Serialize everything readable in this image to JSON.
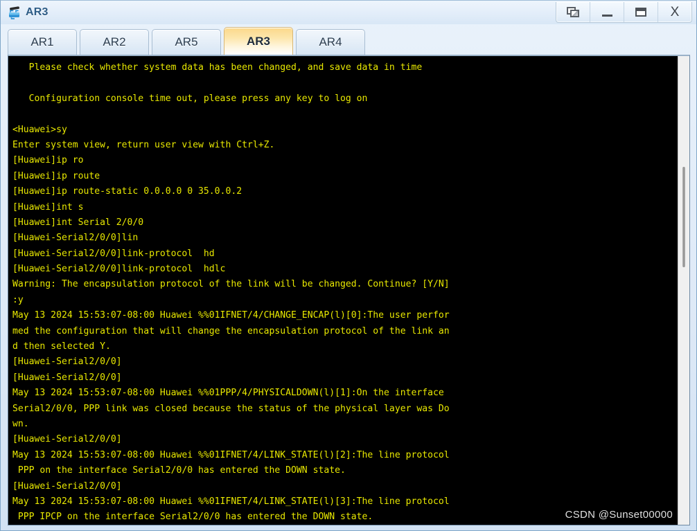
{
  "window": {
    "title": "AR3",
    "icon": "router-icon",
    "controls": [
      {
        "name": "restore-button",
        "glyph": "restore-icon",
        "label": "Restore"
      },
      {
        "name": "minimize-button",
        "glyph": "minimize-icon",
        "label": "Minimize"
      },
      {
        "name": "maximize-button",
        "glyph": "maximize-icon",
        "label": "Maximize"
      },
      {
        "name": "close-button",
        "glyph": "close-icon",
        "label": "X"
      }
    ]
  },
  "tabs": [
    {
      "label": "AR1",
      "active": false
    },
    {
      "label": "AR2",
      "active": false
    },
    {
      "label": "AR5",
      "active": false
    },
    {
      "label": "AR3",
      "active": true
    },
    {
      "label": "AR4",
      "active": false
    }
  ],
  "terminal": {
    "foreground": "#e8e800",
    "background": "#000000",
    "lines": [
      "   Please check whether system data has been changed, and save data in time",
      "",
      "   Configuration console time out, please press any key to log on",
      "",
      "<Huawei>sy",
      "Enter system view, return user view with Ctrl+Z.",
      "[Huawei]ip ro",
      "[Huawei]ip route",
      "[Huawei]ip route-static 0.0.0.0 0 35.0.0.2",
      "[Huawei]int s",
      "[Huawei]int Serial 2/0/0",
      "[Huawei-Serial2/0/0]lin",
      "[Huawei-Serial2/0/0]link-protocol  hd",
      "[Huawei-Serial2/0/0]link-protocol  hdlc",
      "Warning: The encapsulation protocol of the link will be changed. Continue? [Y/N]",
      ":y",
      "May 13 2024 15:53:07-08:00 Huawei %%01IFNET/4/CHANGE_ENCAP(l)[0]:The user perfor",
      "med the configuration that will change the encapsulation protocol of the link an",
      "d then selected Y.",
      "[Huawei-Serial2/0/0]",
      "[Huawei-Serial2/0/0]",
      "May 13 2024 15:53:07-08:00 Huawei %%01PPP/4/PHYSICALDOWN(l)[1]:On the interface",
      "Serial2/0/0, PPP link was closed because the status of the physical layer was Do",
      "wn.",
      "[Huawei-Serial2/0/0]",
      "May 13 2024 15:53:07-08:00 Huawei %%01IFNET/4/LINK_STATE(l)[2]:The line protocol",
      " PPP on the interface Serial2/0/0 has entered the DOWN state.",
      "[Huawei-Serial2/0/0]",
      "May 13 2024 15:53:07-08:00 Huawei %%01IFNET/4/LINK_STATE(l)[3]:The line protocol",
      " PPP IPCP on the interface Serial2/0/0 has entered the DOWN state."
    ]
  },
  "scrollbar": {
    "name": "terminal-scrollbar"
  },
  "watermark": {
    "text": "CSDN @Sunset00000"
  }
}
